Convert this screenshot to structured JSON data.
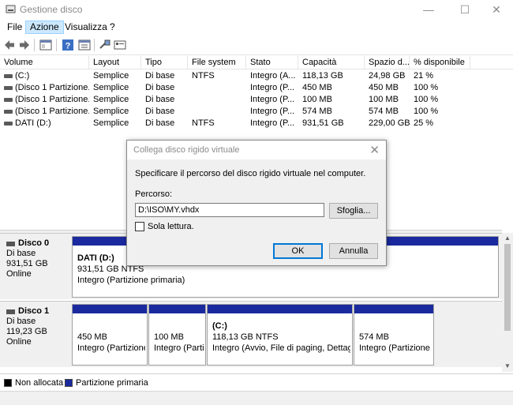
{
  "window": {
    "title": "Gestione disco"
  },
  "menu": [
    "File",
    "Azione",
    "Visualizza",
    "?"
  ],
  "volume_list": {
    "columns": [
      "Volume",
      "Layout",
      "Tipo",
      "File system",
      "Stato",
      "Capacità",
      "Spazio d...",
      "% disponibile"
    ],
    "rows": [
      [
        "(C:)",
        "Semplice",
        "Di base",
        "NTFS",
        "Integro (A...",
        "118,13 GB",
        "24,98 GB",
        "21 %"
      ],
      [
        "(Disco 1 Partizione...",
        "Semplice",
        "Di base",
        "",
        "Integro (P...",
        "450 MB",
        "450 MB",
        "100 %"
      ],
      [
        "(Disco 1 Partizione...",
        "Semplice",
        "Di base",
        "",
        "Integro (P...",
        "100 MB",
        "100 MB",
        "100 %"
      ],
      [
        "(Disco 1 Partizione...",
        "Semplice",
        "Di base",
        "",
        "Integro (P...",
        "574 MB",
        "574 MB",
        "100 %"
      ],
      [
        "DATI (D:)",
        "Semplice",
        "Di base",
        "NTFS",
        "Integro (P...",
        "931,51 GB",
        "229,00 GB",
        "25 %"
      ]
    ]
  },
  "disks": [
    {
      "name": "Disco 0",
      "type": "Di base",
      "size": "931,51 GB",
      "status": "Online",
      "partitions": [
        {
          "label": "DATI  (D:)",
          "size": "931,51 GB NTFS",
          "state": "Integro (Partizione primaria)"
        }
      ]
    },
    {
      "name": "Disco 1",
      "type": "Di base",
      "size": "119,23 GB",
      "status": "Online",
      "partitions": [
        {
          "label": "",
          "size": "450 MB",
          "state": "Integro (Partizione"
        },
        {
          "label": "",
          "size": "100 MB",
          "state": "Integro (Parti"
        },
        {
          "label": "(C:)",
          "size": "118,13 GB NTFS",
          "state": "Integro (Avvio, File di paging, Dettagli"
        },
        {
          "label": "",
          "size": "574 MB",
          "state": "Integro (Partizione c"
        }
      ]
    }
  ],
  "legend": [
    {
      "label": "Non allocata",
      "color": "#000000"
    },
    {
      "label": "Partizione primaria",
      "color": "#1a2a9e"
    }
  ],
  "dialog": {
    "title": "Collega disco rigido virtuale",
    "description": "Specificare il percorso del disco rigido virtuale nel computer.",
    "path_label": "Percorso:",
    "path_value": "D:\\ISO\\MY.vhdx",
    "browse_label": "Sfoglia...",
    "readonly_label": "Sola lettura.",
    "ok_label": "OK",
    "cancel_label": "Annulla"
  },
  "colors": {
    "primary_partition": "#1a2a9e",
    "menu_active": "#cce8ff",
    "default_button_border": "#0078d7"
  }
}
